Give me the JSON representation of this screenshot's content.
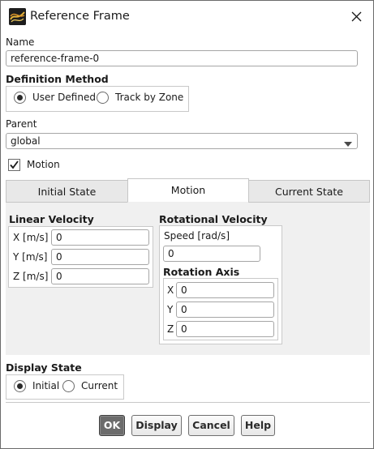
{
  "window": {
    "title": "Reference Frame",
    "icon": "fluent-app-icon",
    "close_icon": "close-icon"
  },
  "name": {
    "label": "Name",
    "value": "reference-frame-0"
  },
  "definition_method": {
    "label": "Definition Method",
    "options": [
      {
        "label": "User Defined",
        "selected": true
      },
      {
        "label": "Track by Zone",
        "selected": false
      }
    ]
  },
  "parent": {
    "label": "Parent",
    "value": "global",
    "dropdown_icon": "chevron-down-icon"
  },
  "motion_checkbox": {
    "label": "Motion",
    "checked": true
  },
  "tabs": [
    {
      "label": "Initial State",
      "active": false
    },
    {
      "label": "Motion",
      "active": true
    },
    {
      "label": "Current State",
      "active": false
    }
  ],
  "linear_velocity": {
    "label": "Linear Velocity",
    "fields": [
      {
        "label": "X [m/s]",
        "value": "0"
      },
      {
        "label": "Y [m/s]",
        "value": "0"
      },
      {
        "label": "Z [m/s]",
        "value": "0"
      }
    ]
  },
  "rotational_velocity": {
    "label": "Rotational Velocity",
    "speed_label": "Speed [rad/s]",
    "speed_value": "0",
    "axis_label": "Rotation Axis",
    "axis_fields": [
      {
        "label": "X",
        "value": "0"
      },
      {
        "label": "Y",
        "value": "0"
      },
      {
        "label": "Z",
        "value": "0"
      }
    ]
  },
  "display_state": {
    "label": "Display State",
    "options": [
      {
        "label": "Initial",
        "selected": true
      },
      {
        "label": "Current",
        "selected": false
      }
    ]
  },
  "buttons": {
    "ok": "OK",
    "display": "Display",
    "cancel": "Cancel",
    "help": "Help"
  },
  "colors": {
    "panel_background": "#f0f0f0",
    "primary_button": "#6c6c6c"
  }
}
